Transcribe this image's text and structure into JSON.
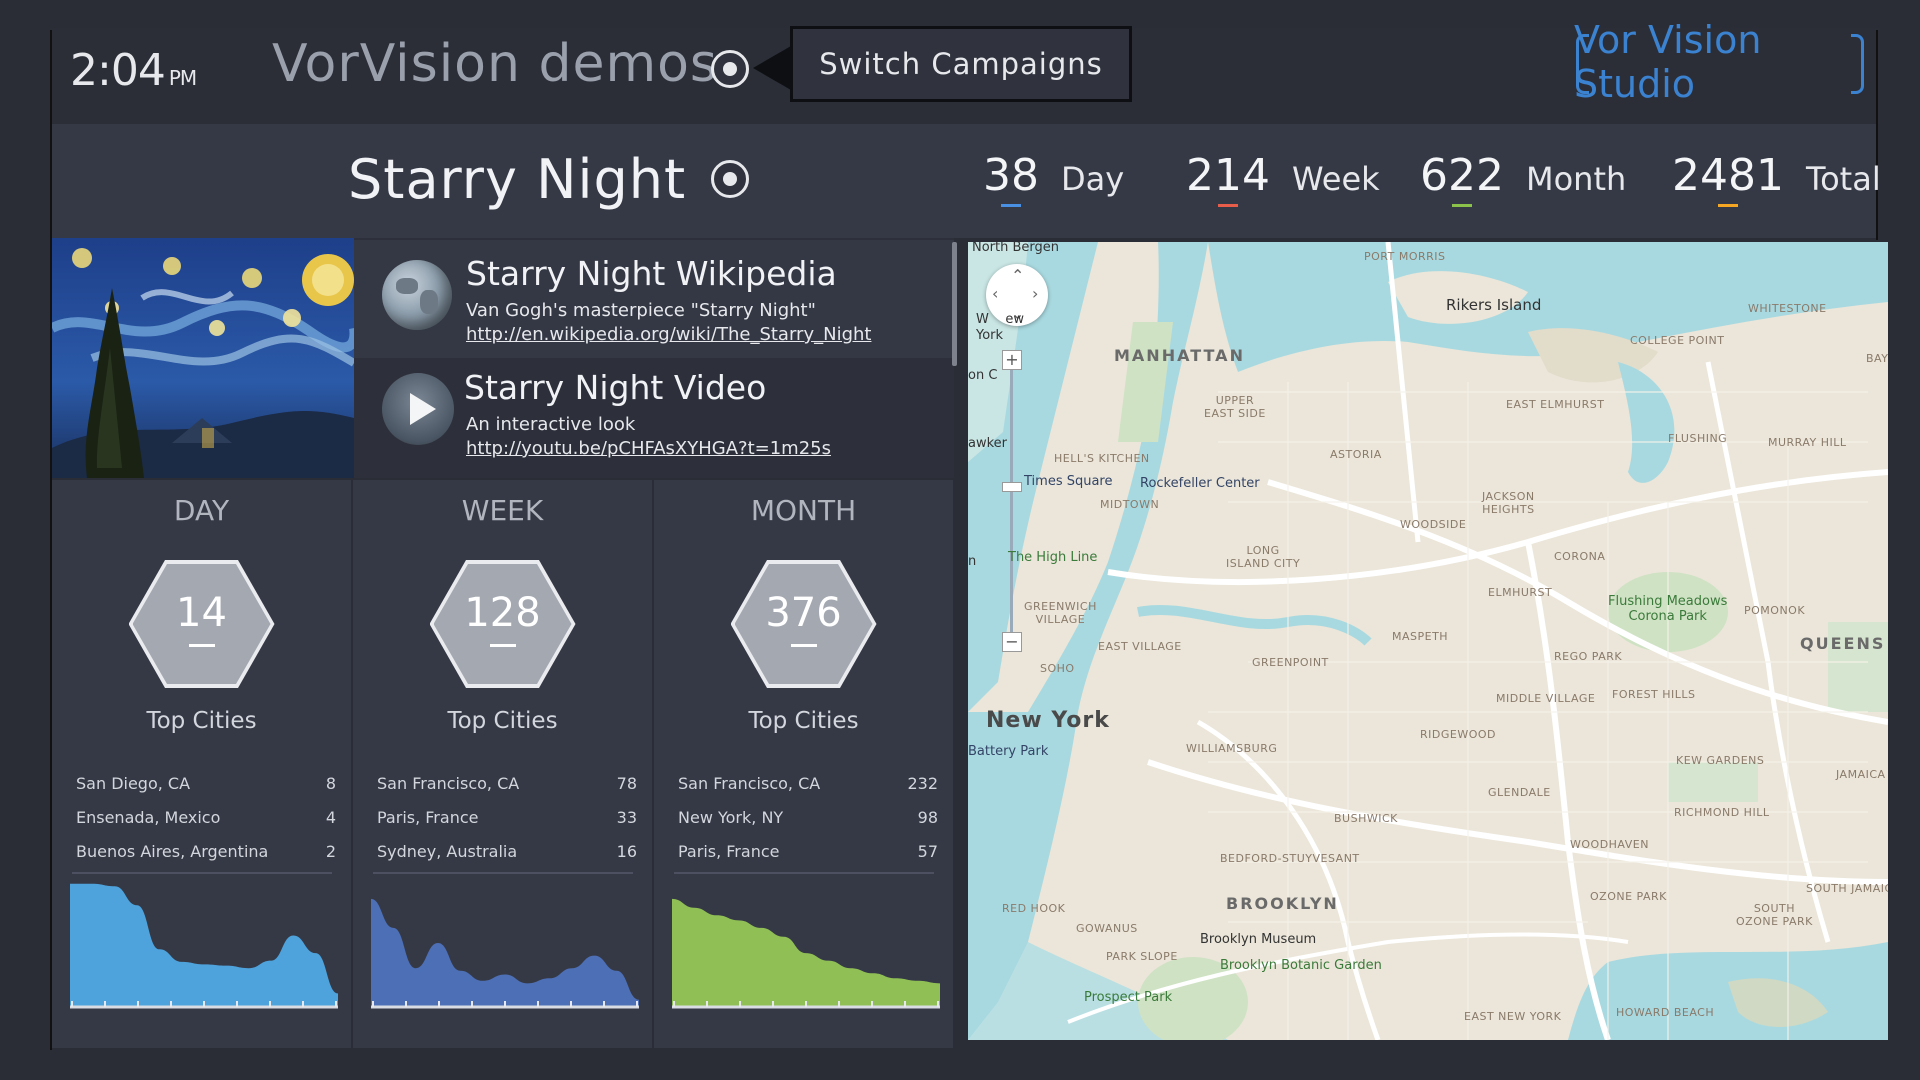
{
  "header": {
    "time": "2:04",
    "ampm": "PM",
    "app_title": "VorVision demos",
    "switch_label": "Switch Campaigns",
    "brand": "Vor Vision Studio"
  },
  "campaign": {
    "title": "Starry Night",
    "stats": [
      {
        "value": "38",
        "label": "Day",
        "color": "#4a90e2"
      },
      {
        "value": "214",
        "label": "Week",
        "color": "#e85d4a"
      },
      {
        "value": "622",
        "label": "Month",
        "color": "#8bc34a"
      },
      {
        "value": "2481",
        "label": "Total",
        "color": "#f5a623"
      }
    ]
  },
  "links": [
    {
      "title": "Starry Night Wikipedia",
      "description": "Van Gogh's masterpiece \"Starry Night\"",
      "url": "http://en.wikipedia.org/wiki/The_Starry_Night",
      "icon": "globe-icon"
    },
    {
      "title": "Starry Night Video",
      "description": "An interactive look",
      "url": "http://youtu.be/pCHFAsXYHGA?t=1m25s",
      "icon": "play-icon"
    }
  ],
  "periods": [
    {
      "title": "DAY",
      "count": "14",
      "top_label": "Top Cities",
      "color": "#4ea3dd",
      "cities": [
        {
          "name": "San Diego, CA",
          "count": "8"
        },
        {
          "name": "Ensenada, Mexico",
          "count": "4"
        },
        {
          "name": "Buenos Aires, Argentina",
          "count": "2"
        }
      ],
      "trend": [
        0.97,
        0.97,
        0.95,
        0.8,
        0.45,
        0.35,
        0.33,
        0.32,
        0.3,
        0.36,
        0.56,
        0.42,
        0.1
      ]
    },
    {
      "title": "WEEK",
      "count": "128",
      "top_label": "Top Cities",
      "color": "#4d6fb6",
      "cities": [
        {
          "name": "San Francisco, CA",
          "count": "78"
        },
        {
          "name": "Paris, France",
          "count": "33"
        },
        {
          "name": "Sydney, Australia",
          "count": "16"
        }
      ],
      "trend": [
        0.85,
        0.62,
        0.3,
        0.5,
        0.28,
        0.2,
        0.25,
        0.18,
        0.22,
        0.3,
        0.4,
        0.28,
        0.05
      ]
    },
    {
      "title": "MONTH",
      "count": "376",
      "top_label": "Top Cities",
      "color": "#8fbf55",
      "cities": [
        {
          "name": "San Francisco, CA",
          "count": "232"
        },
        {
          "name": "New York, NY",
          "count": "98"
        },
        {
          "name": "Paris, France",
          "count": "57"
        }
      ],
      "trend": [
        0.85,
        0.78,
        0.72,
        0.68,
        0.62,
        0.55,
        0.42,
        0.36,
        0.3,
        0.26,
        0.22,
        0.2,
        0.18
      ]
    }
  ],
  "map": {
    "labels": {
      "north_bergen": "North Bergen",
      "port_morris": "PORT MORRIS",
      "rikers": "Rikers Island",
      "whitestone": "WHITESTONE",
      "college_point": "COLLEGE POINT",
      "bay_t": "BAY T",
      "manhattan": "MANHATTAN",
      "upper_east": "UPPER\nEAST SIDE",
      "east_elmhurst": "EAST ELMHURST",
      "flushing": "FLUSHING",
      "murray_hill": "MURRAY HILL",
      "hells_kitchen": "HELL'S KITCHEN",
      "astoria": "ASTORIA",
      "times_square": "Times Square",
      "rockefeller": "Rockefeller Center",
      "midtown": "MIDTOWN",
      "jackson_heights": "JACKSON\nHEIGHTS",
      "woodside": "WOODSIDE",
      "high_line": "The High Line",
      "long_island_city": "LONG\nISLAND CITY",
      "corona": "CORONA",
      "elmhurst": "ELMHURST",
      "flushing_meadows": "Flushing Meadows\nCorona Park",
      "pomonok": "POMONOK",
      "greenwich": "GREENWICH\nVILLAGE",
      "east_village": "EAST VILLAGE",
      "greenpoint": "GREENPOINT",
      "maspeth": "MASPETH",
      "rego_park": "REGO PARK",
      "queens": "QUEENS",
      "soho": "SOHO",
      "middle_village": "MIDDLE VILLAGE",
      "forest_hills": "FOREST HILLS",
      "new_york": "New York",
      "battery_park": "Battery Park",
      "williamsburg": "WILLIAMSBURG",
      "ridgewood": "RIDGEWOOD",
      "kew_gardens": "KEW GARDENS",
      "jamaica": "JAMAICA",
      "glendale": "GLENDALE",
      "bushwick": "BUSHWICK",
      "richmond_hill": "RICHMOND HILL",
      "woodhaven": "WOODHAVEN",
      "bedford": "BEDFORD-STUYVESANT",
      "ozone_park": "OZONE PARK",
      "south_ozone": "SOUTH\nOZONE PARK",
      "south_jamaica": "SOUTH JAMAIC",
      "red_hook": "RED HOOK",
      "brooklyn": "BROOKLYN",
      "gowanus": "GOWANUS",
      "brooklyn_museum": "Brooklyn Museum",
      "park_slope": "PARK SLOPE",
      "botanic": "Brooklyn Botanic Garden",
      "prospect_park": "Prospect Park",
      "east_new_york": "EAST NEW YORK",
      "howard_beach": "HOWARD BEACH",
      "w_new_york": "W    ew\nYork",
      "on_c": "on C",
      "awker": "awker",
      "n_edge": "n"
    }
  }
}
